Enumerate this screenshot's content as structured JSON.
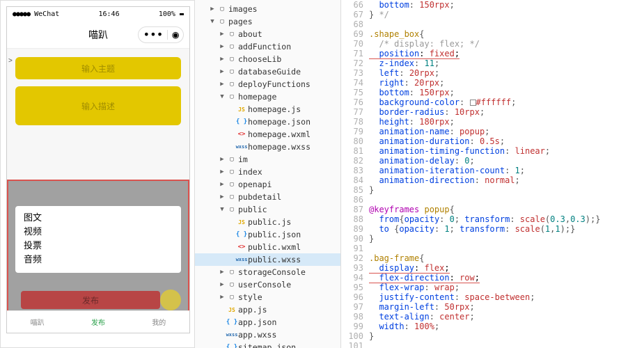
{
  "phone": {
    "status": {
      "carrier": "WeChat",
      "time": "16:46",
      "battery": "100%"
    },
    "nav_title": "喵趴",
    "prompt_char": ">",
    "input_topic": "输入主题",
    "input_desc": "输入描述",
    "popup": [
      "图文",
      "视频",
      "投票",
      "音频"
    ],
    "publish_btn": "发布",
    "tabs": [
      "喵趴",
      "发布",
      "我的"
    ],
    "tabs_active_index": 1
  },
  "tree": [
    {
      "depth": 1,
      "arrow": "right",
      "kind": "folder",
      "label": "images"
    },
    {
      "depth": 1,
      "arrow": "down",
      "kind": "folder",
      "label": "pages"
    },
    {
      "depth": 2,
      "arrow": "right",
      "kind": "folder",
      "label": "about"
    },
    {
      "depth": 2,
      "arrow": "right",
      "kind": "folder",
      "label": "addFunction"
    },
    {
      "depth": 2,
      "arrow": "right",
      "kind": "folder",
      "label": "chooseLib"
    },
    {
      "depth": 2,
      "arrow": "right",
      "kind": "folder",
      "label": "databaseGuide"
    },
    {
      "depth": 2,
      "arrow": "right",
      "kind": "folder",
      "label": "deployFunctions"
    },
    {
      "depth": 2,
      "arrow": "down",
      "kind": "folder",
      "label": "homepage"
    },
    {
      "depth": 3,
      "arrow": "",
      "kind": "js",
      "label": "homepage.js"
    },
    {
      "depth": 3,
      "arrow": "",
      "kind": "json",
      "label": "homepage.json"
    },
    {
      "depth": 3,
      "arrow": "",
      "kind": "wxml",
      "label": "homepage.wxml"
    },
    {
      "depth": 3,
      "arrow": "",
      "kind": "wxss",
      "label": "homepage.wxss"
    },
    {
      "depth": 2,
      "arrow": "right",
      "kind": "folder",
      "label": "im"
    },
    {
      "depth": 2,
      "arrow": "right",
      "kind": "folder",
      "label": "index"
    },
    {
      "depth": 2,
      "arrow": "right",
      "kind": "folder",
      "label": "openapi"
    },
    {
      "depth": 2,
      "arrow": "right",
      "kind": "folder",
      "label": "pubdetail"
    },
    {
      "depth": 2,
      "arrow": "down",
      "kind": "folder",
      "label": "public"
    },
    {
      "depth": 3,
      "arrow": "",
      "kind": "js",
      "label": "public.js"
    },
    {
      "depth": 3,
      "arrow": "",
      "kind": "json",
      "label": "public.json"
    },
    {
      "depth": 3,
      "arrow": "",
      "kind": "wxml",
      "label": "public.wxml"
    },
    {
      "depth": 3,
      "arrow": "",
      "kind": "wxss",
      "label": "public.wxss",
      "selected": true
    },
    {
      "depth": 2,
      "arrow": "right",
      "kind": "folder",
      "label": "storageConsole"
    },
    {
      "depth": 2,
      "arrow": "right",
      "kind": "folder",
      "label": "userConsole"
    },
    {
      "depth": 2,
      "arrow": "right",
      "kind": "folder",
      "label": "style"
    },
    {
      "depth": 2,
      "arrow": "",
      "kind": "js",
      "label": "app.js"
    },
    {
      "depth": 2,
      "arrow": "",
      "kind": "json",
      "label": "app.json"
    },
    {
      "depth": 2,
      "arrow": "",
      "kind": "wxss",
      "label": "app.wxss"
    },
    {
      "depth": 2,
      "arrow": "",
      "kind": "json",
      "label": "sitemap.json"
    }
  ],
  "code": {
    "first_line": 66,
    "lines": [
      [
        [
          "prop",
          "  bottom"
        ],
        [
          "punc",
          ": "
        ],
        [
          "val",
          "150rpx"
        ],
        [
          "punc",
          ";"
        ]
      ],
      [
        [
          "punc",
          "} "
        ],
        [
          "comment",
          "*/"
        ]
      ],
      [],
      [
        [
          "sel",
          ".shape_box"
        ],
        [
          "punc",
          "{"
        ]
      ],
      [
        [
          "comment",
          "  /* display: flex; */"
        ]
      ],
      [
        [
          "ul",
          "  position: fixed;"
        ]
      ],
      [
        [
          "prop",
          "  z-index"
        ],
        [
          "punc",
          ": "
        ],
        [
          "num",
          "11"
        ],
        [
          "punc",
          ";"
        ]
      ],
      [
        [
          "prop",
          "  left"
        ],
        [
          "punc",
          ": "
        ],
        [
          "val",
          "20rpx"
        ],
        [
          "punc",
          ";"
        ]
      ],
      [
        [
          "prop",
          "  right"
        ],
        [
          "punc",
          ": "
        ],
        [
          "val",
          "20rpx"
        ],
        [
          "punc",
          ";"
        ]
      ],
      [
        [
          "prop",
          "  bottom"
        ],
        [
          "punc",
          ": "
        ],
        [
          "val",
          "150rpx"
        ],
        [
          "punc",
          ";"
        ]
      ],
      [
        [
          "prop",
          "  background-color"
        ],
        [
          "punc",
          ": "
        ],
        [
          "swatch",
          ""
        ],
        [
          "val",
          "#ffffff"
        ],
        [
          "punc",
          ";"
        ]
      ],
      [
        [
          "prop",
          "  border-radius"
        ],
        [
          "punc",
          ": "
        ],
        [
          "val",
          "10rpx"
        ],
        [
          "punc",
          ";"
        ]
      ],
      [
        [
          "prop",
          "  height"
        ],
        [
          "punc",
          ": "
        ],
        [
          "val",
          "180rpx"
        ],
        [
          "punc",
          ";"
        ]
      ],
      [
        [
          "prop",
          "  animation-name"
        ],
        [
          "punc",
          ": "
        ],
        [
          "val",
          "popup"
        ],
        [
          "punc",
          ";"
        ]
      ],
      [
        [
          "prop",
          "  animation-duration"
        ],
        [
          "punc",
          ": "
        ],
        [
          "val",
          "0.5s"
        ],
        [
          "punc",
          ";"
        ]
      ],
      [
        [
          "prop",
          "  animation-timing-function"
        ],
        [
          "punc",
          ": "
        ],
        [
          "val",
          "linear"
        ],
        [
          "punc",
          ";"
        ]
      ],
      [
        [
          "prop",
          "  animation-delay"
        ],
        [
          "punc",
          ": "
        ],
        [
          "num",
          "0"
        ],
        [
          "punc",
          ";"
        ]
      ],
      [
        [
          "prop",
          "  animation-iteration-count"
        ],
        [
          "punc",
          ": "
        ],
        [
          "num",
          "1"
        ],
        [
          "punc",
          ";"
        ]
      ],
      [
        [
          "prop",
          "  animation-direction"
        ],
        [
          "punc",
          ": "
        ],
        [
          "val",
          "normal"
        ],
        [
          "punc",
          ";"
        ]
      ],
      [
        [
          "punc",
          "}"
        ]
      ],
      [],
      [
        [
          "kw",
          "@keyframes"
        ],
        [
          "sel",
          " popup"
        ],
        [
          "punc",
          "{"
        ]
      ],
      [
        [
          "prop",
          "  from"
        ],
        [
          "punc",
          "{"
        ],
        [
          "prop",
          "opacity"
        ],
        [
          "punc",
          ": "
        ],
        [
          "num",
          "0"
        ],
        [
          "punc",
          "; "
        ],
        [
          "prop",
          "transform"
        ],
        [
          "punc",
          ": "
        ],
        [
          "val",
          "scale"
        ],
        [
          "punc",
          "("
        ],
        [
          "num",
          "0.3"
        ],
        [
          "punc",
          ","
        ],
        [
          "num",
          "0.3"
        ],
        [
          "punc",
          ");}"
        ]
      ],
      [
        [
          "prop",
          "  to "
        ],
        [
          "punc",
          "{"
        ],
        [
          "prop",
          "opacity"
        ],
        [
          "punc",
          ": "
        ],
        [
          "num",
          "1"
        ],
        [
          "punc",
          "; "
        ],
        [
          "prop",
          "transform"
        ],
        [
          "punc",
          ": "
        ],
        [
          "val",
          "scale"
        ],
        [
          "punc",
          "("
        ],
        [
          "num",
          "1"
        ],
        [
          "punc",
          ","
        ],
        [
          "num",
          "1"
        ],
        [
          "punc",
          ");}"
        ]
      ],
      [
        [
          "punc",
          "}"
        ]
      ],
      [],
      [
        [
          "sel",
          ".bag-frame"
        ],
        [
          "punc",
          "{"
        ]
      ],
      [
        [
          "ul",
          "  display: flex;"
        ]
      ],
      [
        [
          "ul",
          "  flex-direction: row;"
        ]
      ],
      [
        [
          "prop",
          "  flex-wrap"
        ],
        [
          "punc",
          ": "
        ],
        [
          "val",
          "wrap"
        ],
        [
          "punc",
          ";"
        ]
      ],
      [
        [
          "prop",
          "  justify-content"
        ],
        [
          "punc",
          ": "
        ],
        [
          "val",
          "space-between"
        ],
        [
          "punc",
          ";"
        ]
      ],
      [
        [
          "prop",
          "  margin-left"
        ],
        [
          "punc",
          ": "
        ],
        [
          "val",
          "50rpx"
        ],
        [
          "punc",
          ";"
        ]
      ],
      [
        [
          "prop",
          "  text-align"
        ],
        [
          "punc",
          ": "
        ],
        [
          "val",
          "center"
        ],
        [
          "punc",
          ";"
        ]
      ],
      [
        [
          "prop",
          "  width"
        ],
        [
          "punc",
          ": "
        ],
        [
          "val",
          "100%"
        ],
        [
          "punc",
          ";"
        ]
      ],
      [
        [
          "punc",
          "}"
        ]
      ],
      []
    ]
  }
}
